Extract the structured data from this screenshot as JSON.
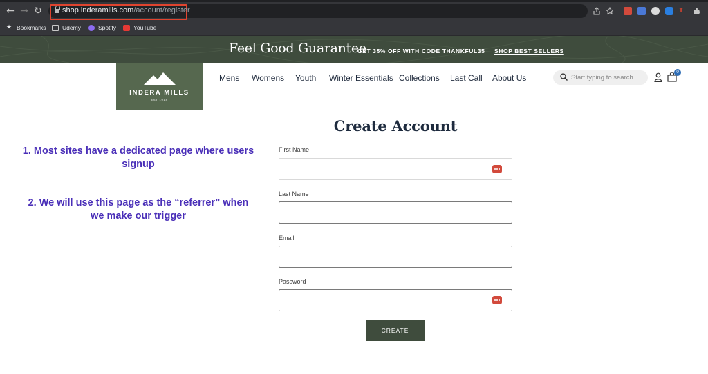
{
  "browser": {
    "url_host": "shop.inderamills.com",
    "url_path": "/account/register",
    "bookmarks": [
      "Bookmarks",
      "Udemy",
      "Spotify",
      "YouTube"
    ]
  },
  "promo": {
    "title": "Feel Good Guarantee",
    "code_text": "GET 35% OFF WITH CODE THANKFUL35",
    "link_text": "SHOP BEST SELLERS"
  },
  "header": {
    "logo_text": "INDERA MILLS",
    "logo_sub": "EST 1914",
    "nav": [
      "Mens",
      "Womens",
      "Youth",
      "Winter Essentials",
      "Collections",
      "Last Call",
      "About Us"
    ],
    "search_placeholder": "Start typing to search",
    "cart_count": "0"
  },
  "form": {
    "title": "Create Account",
    "fields": [
      {
        "label": "First Name",
        "value": ""
      },
      {
        "label": "Last Name",
        "value": ""
      },
      {
        "label": "Email",
        "value": ""
      },
      {
        "label": "Password",
        "value": ""
      }
    ],
    "submit_label": "CREATE"
  },
  "annotations": {
    "note1": "1. Most sites have a dedicated page where users signup",
    "note2": "2. We will use this page as the “referrer” when we make our trigger"
  },
  "colors": {
    "brand_green": "#3f4c3d",
    "logo_green": "#56684f",
    "annotation": "#4a2fb8",
    "url_highlight": "#e0442f"
  }
}
